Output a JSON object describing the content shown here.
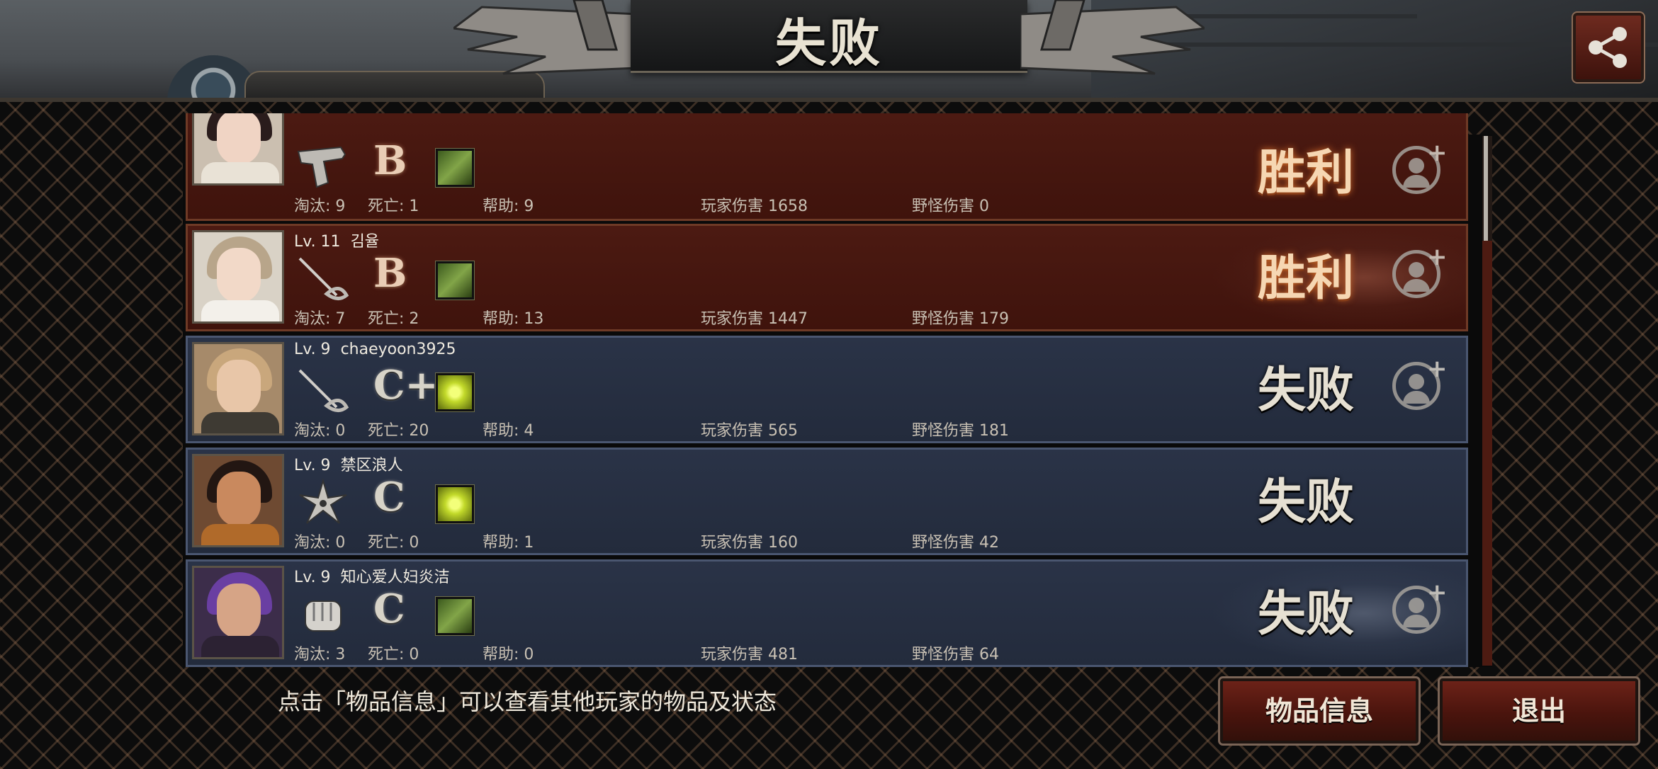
{
  "title": "失败",
  "share_icon": "share-icon",
  "name_peek": "禁区浪人",
  "rows": [
    {
      "level": "",
      "name": "",
      "weapon": "pistol-icon",
      "grade": "B",
      "item": "green-item-icon",
      "kills": "淘汰: 9",
      "deaths": "死亡: 1",
      "assists": "帮助: 9",
      "player_damage": "玩家伤害 1658",
      "monster_damage": "野怪伤害 0",
      "result": "胜利"
    },
    {
      "level": "Lv. 11",
      "name": "김율",
      "weapon": "rapier-icon",
      "grade": "B",
      "item": "green-item-icon",
      "kills": "淘汰: 7",
      "deaths": "死亡: 2",
      "assists": "帮助: 13",
      "player_damage": "玩家伤害 1447",
      "monster_damage": "野怪伤害 179",
      "result": "胜利"
    },
    {
      "level": "Lv. 9",
      "name": "chaeyoon3925",
      "weapon": "rapier-icon",
      "grade": "C+",
      "item": "yellow-item-icon",
      "kills": "淘汰: 0",
      "deaths": "死亡: 20",
      "assists": "帮助: 4",
      "player_damage": "玩家伤害 565",
      "monster_damage": "野怪伤害 181",
      "result": "失败"
    },
    {
      "level": "Lv. 9",
      "name": "禁区浪人",
      "weapon": "shuriken-icon",
      "grade": "C",
      "item": "yellow-item-icon",
      "kills": "淘汰: 0",
      "deaths": "死亡: 0",
      "assists": "帮助: 1",
      "player_damage": "玩家伤害 160",
      "monster_damage": "野怪伤害 42",
      "result": "失败"
    },
    {
      "level": "Lv. 9",
      "name": "知心爱人妇炎洁",
      "weapon": "glove-icon",
      "grade": "C",
      "item": "green-item-icon",
      "kills": "淘汰: 3",
      "deaths": "死亡: 0",
      "assists": "帮助: 0",
      "player_damage": "玩家伤害 481",
      "monster_damage": "野怪伤害 64",
      "result": "失败"
    }
  ],
  "hint": "点击「物品信息」可以查看其他玩家的物品及状态",
  "buttons": {
    "item_info": "物品信息",
    "exit": "退出"
  },
  "colors": {
    "win_row": "#4c1a12",
    "lose_row": "#2a3347",
    "button": "#6c2218"
  }
}
